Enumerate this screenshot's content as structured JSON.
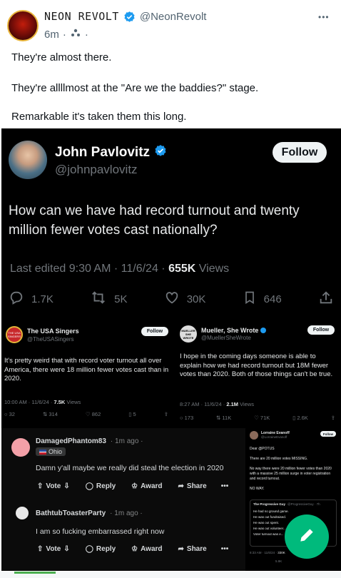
{
  "post": {
    "display_name": "NEON REVOLT",
    "handle": "@NeonRevolt",
    "time": "6m",
    "dot": "·",
    "more": "•••",
    "lines": [
      "They're almost there.",
      "They're allllmost at the \"Are we the baddies?\" stage.",
      "Remarkable it's taken them this long."
    ]
  },
  "main": {
    "name": "John Pavlovitz",
    "handle": "@johnpavlovitz",
    "follow": "Follow",
    "text": "How can we have had record turnout and twenty million fewer votes cast nationally?",
    "edited": "Last edited 9:30 AM · 11/6/24 · ",
    "views_count": "655K",
    "views_label": " Views",
    "replies": "1.7K",
    "reposts": "5K",
    "likes": "30K",
    "bookmarks": "646"
  },
  "singers": {
    "name": "The USA Singers",
    "handle": "@TheUSASingers",
    "follow": "Follow",
    "avatar_text": "THE USA SINGERS",
    "text": "It's pretty weird that with record voter turnout all over America, there were 18 million fewer votes cast than in 2020.",
    "meta": "10:00 AM · 11/6/24 · ",
    "views_count": "7.5K",
    "views_label": " Views",
    "replies": "32",
    "reposts": "314",
    "likes": "862",
    "bookmarks": "5"
  },
  "mueller": {
    "name": "Mueller, She Wrote",
    "handle": "@MuellerSheWrote",
    "follow": "Follow",
    "avatar_text": "MUELLER SHE WROTE",
    "text": "I hope in the coming days someone is able to explain how we had record turnout but 18M fewer votes than 2020. Both of those things can't be true.",
    "meta": "8:27 AM · 11/6/24 · ",
    "views_count": "2.1M",
    "views_label": " Views",
    "replies": "173",
    "reposts": "11K",
    "likes": "71K",
    "bookmarks": "2.6K"
  },
  "reddit": [
    {
      "user": "DamagedPhantom83",
      "time": "· 1m ago ·",
      "flair": "Ohio",
      "text": "Damn y'all maybe we really did steal the election in 2020"
    },
    {
      "user": "BathtubToasterParty",
      "time": "· 1m ago ·",
      "text": "I am so fucking embarrassed right now"
    }
  ],
  "reddit_actions": {
    "vote": "Vote",
    "reply": "Reply",
    "award": "Award",
    "share": "Share",
    "more": "•••"
  },
  "lorraine": {
    "name": "Lorraine Evanoff",
    "handle": "@LorraineEvanoff",
    "follow": "Follow",
    "lines": [
      "Dear @POTUS",
      "There are 20 million votes MISSING.",
      "No way there were 20 million fewer votes than 2020 with a massive 25 million surge in voter registration and record turnout.",
      "NO WAY."
    ],
    "quote_name": "The Progressive Guy",
    "quote_handle": "@ProgressiveGuy · 7h",
    "quote_lines": [
      "He had no ground game.",
      "He was out fundraised.",
      "He was out spent.",
      "He was out volunteer...",
      "Voter turnout was e..."
    ],
    "meta": "8:33 AM · 11/6/24 · ",
    "meta_views": "330K",
    "reposts": "5.9K"
  },
  "colors": {
    "blue": "#1d9bf0",
    "fab": "#00ba7c",
    "black": "#000000"
  }
}
